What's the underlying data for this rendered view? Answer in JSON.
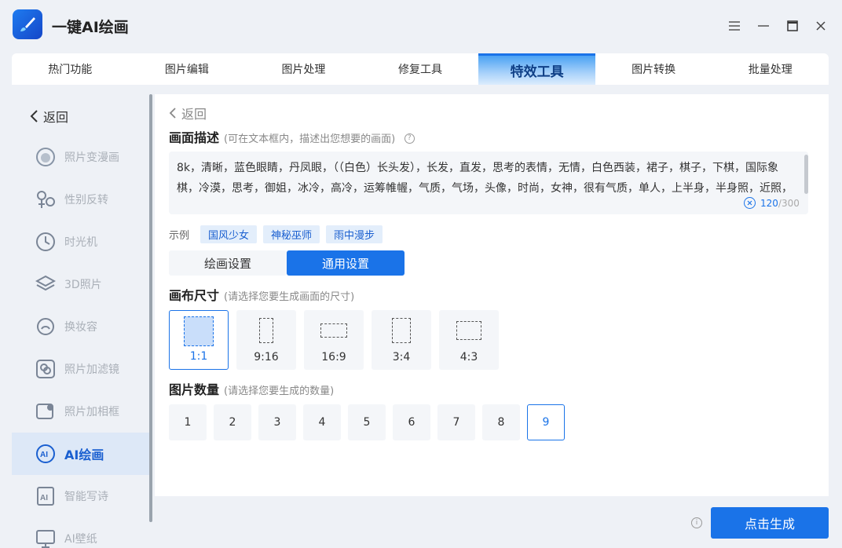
{
  "app": {
    "title": "一键AI绘画"
  },
  "tabs": [
    "热门功能",
    "图片编辑",
    "图片处理",
    "修复工具",
    "特效工具",
    "图片转换",
    "批量处理"
  ],
  "sidebar": {
    "back": "返回",
    "items": [
      {
        "label": "照片变漫画",
        "icon": "cartoon-face-icon"
      },
      {
        "label": "性别反转",
        "icon": "gender-icon"
      },
      {
        "label": "时光机",
        "icon": "clock-icon"
      },
      {
        "label": "3D照片",
        "icon": "layers-icon"
      },
      {
        "label": "换妆容",
        "icon": "makeup-icon"
      },
      {
        "label": "照片加滤镜",
        "icon": "filter-icon"
      },
      {
        "label": "照片加相框",
        "icon": "frame-icon"
      },
      {
        "label": "AI绘画",
        "icon": "ai-paint-icon"
      },
      {
        "label": "智能写诗",
        "icon": "ai-poem-icon"
      },
      {
        "label": "AI壁纸",
        "icon": "wallpaper-icon"
      }
    ]
  },
  "main": {
    "back": "返回",
    "desc_title": "画面描述",
    "desc_hint": "(可在文本框内，描述出您想要的画面)",
    "prompt_text": "8k，清晰，蓝色眼睛，丹凤眼，（（白色）长头发），长发，直发，思考的表情，无情，白色西装，裙子，棋子，下棋，国际象棋，冷漠，思考，御姐，冰冷，高冷，运筹帷幄，气质，气场，头像，时尚，女神，很有气质，单人，上半身，半身照，近照，",
    "count_current": "120",
    "count_max": "/300",
    "examples_label": "示例",
    "examples": [
      "国风少女",
      "神秘巫师",
      "雨中漫步"
    ],
    "settings_tabs": [
      "绘画设置",
      "通用设置"
    ],
    "canvas_title": "画布尺寸",
    "canvas_hint": "(请选择您要生成画面的尺寸)",
    "sizes": [
      "1:1",
      "9:16",
      "16:9",
      "3:4",
      "4:3"
    ],
    "selected_size": "1:1",
    "count_title": "图片数量",
    "count_hint": "(请选择您要生成的数量)",
    "counts": [
      "1",
      "2",
      "3",
      "4",
      "5",
      "6",
      "7",
      "8",
      "9"
    ],
    "selected_count": "9"
  },
  "footer": {
    "generate": "点击生成"
  },
  "colors": {
    "accent": "#1a73e8",
    "bg": "#eef1f6"
  }
}
